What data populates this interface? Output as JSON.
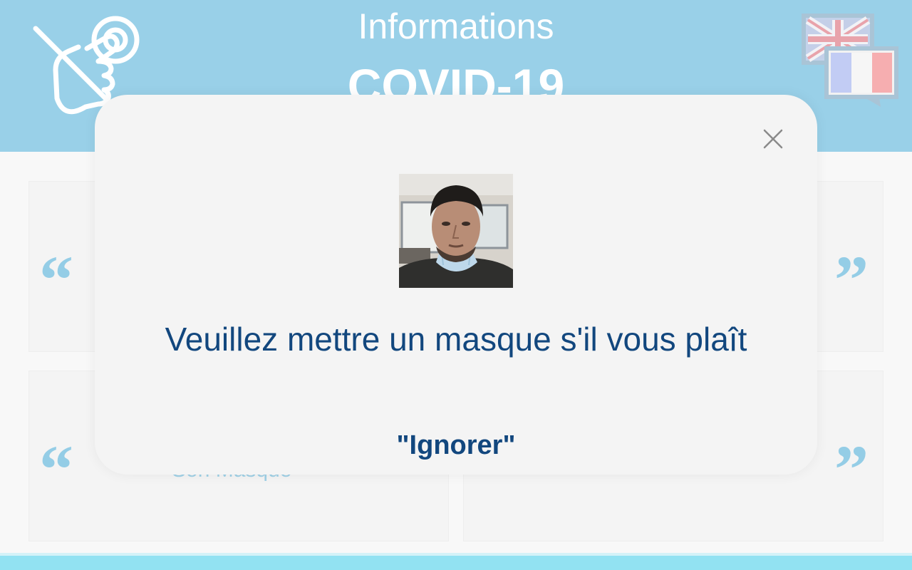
{
  "header": {
    "title_line1": "Informations",
    "title_line2": "COVID-19",
    "no_touch_icon": "no-touch-hand-icon",
    "language_icon": "language-switch-flags-icon"
  },
  "cards": [
    {
      "open_quote": "“",
      "close_quote": "”",
      "caption": ""
    },
    {
      "open_quote": "“",
      "close_quote": "”",
      "caption": ""
    },
    {
      "open_quote": "“",
      "close_quote": "”",
      "caption": "Son Masque"
    },
    {
      "open_quote": "“",
      "close_quote": "”",
      "caption": ""
    }
  ],
  "modal": {
    "close_icon": "close-icon",
    "photo": "captured-face-photo",
    "message": "Veuillez mettre un masque s'il vous plaît",
    "ignore_label": "\"Ignorer\""
  },
  "colors": {
    "header_bg": "#99d0e8",
    "quote": "#94cde6",
    "text_primary": "#12477e",
    "modal_bg": "#f4f4f4",
    "bottom_bar": "#92e2f2"
  }
}
